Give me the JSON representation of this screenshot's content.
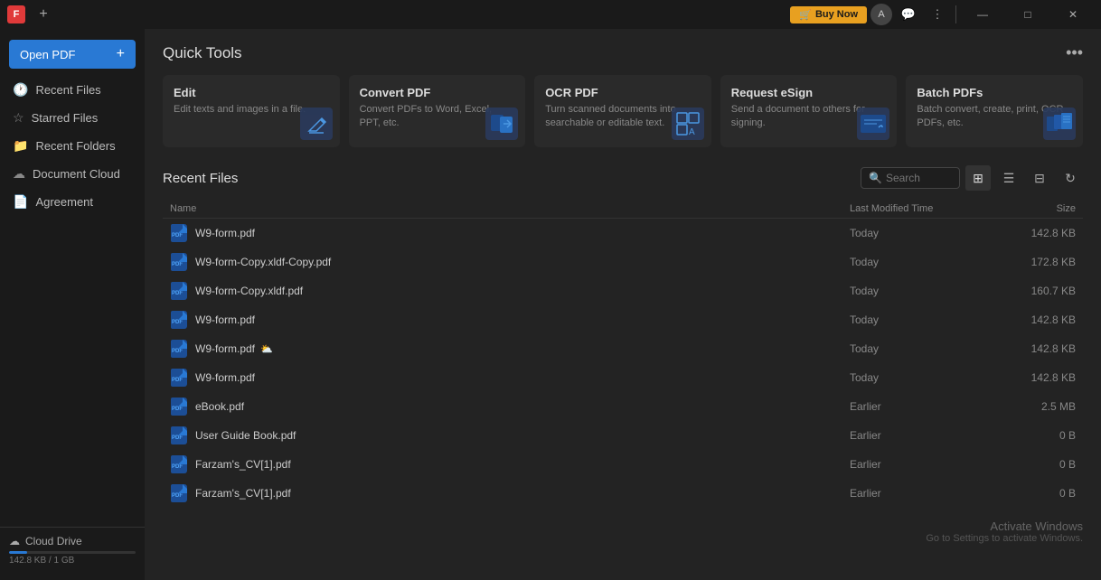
{
  "titlebar": {
    "app_logo": "F",
    "tab_plus": "+",
    "buy_now": "Buy Now",
    "avatar_initials": "A",
    "minimize": "—",
    "maximize": "□",
    "close": "✕"
  },
  "sidebar": {
    "open_pdf": "Open PDF",
    "add_icon": "+",
    "items": [
      {
        "id": "recent-files",
        "label": "Recent Files",
        "icon": "🕐"
      },
      {
        "id": "starred-files",
        "label": "Starred Files",
        "icon": "☆"
      },
      {
        "id": "recent-folders",
        "label": "Recent Folders",
        "icon": "📁"
      },
      {
        "id": "document-cloud",
        "label": "Document Cloud",
        "icon": "☁"
      },
      {
        "id": "agreement",
        "label": "Agreement",
        "icon": "📄"
      }
    ],
    "cloud_drive": "Cloud Drive",
    "storage_used": "142.8 KB / 1 GB"
  },
  "content": {
    "quick_tools_title": "Quick Tools",
    "more_icon": "•••",
    "tools": [
      {
        "id": "edit",
        "name": "Edit",
        "desc": "Edit texts and images in a file."
      },
      {
        "id": "convert-pdf",
        "name": "Convert PDF",
        "desc": "Convert PDFs to Word, Excel, PPT, etc."
      },
      {
        "id": "ocr-pdf",
        "name": "OCR PDF",
        "desc": "Turn scanned documents into searchable or editable text."
      },
      {
        "id": "request-esign",
        "name": "Request eSign",
        "desc": "Send a document to others for signing."
      },
      {
        "id": "batch-pdfs",
        "name": "Batch PDFs",
        "desc": "Batch convert, create, print, OCR PDFs, etc."
      }
    ],
    "recent_files_title": "Recent Files",
    "search_placeholder": "Search",
    "table_headers": {
      "name": "Name",
      "modified": "Last Modified Time",
      "size": "Size"
    },
    "files": [
      {
        "name": "W9-form.pdf",
        "modified": "Today",
        "size": "142.8 KB",
        "cloud": false
      },
      {
        "name": "W9-form-Copy.xldf-Copy.pdf",
        "modified": "Today",
        "size": "172.8 KB",
        "cloud": false
      },
      {
        "name": "W9-form-Copy.xldf.pdf",
        "modified": "Today",
        "size": "160.7 KB",
        "cloud": false
      },
      {
        "name": "W9-form.pdf",
        "modified": "Today",
        "size": "142.8 KB",
        "cloud": false
      },
      {
        "name": "W9-form.pdf",
        "modified": "Today",
        "size": "142.8 KB",
        "cloud": true
      },
      {
        "name": "W9-form.pdf",
        "modified": "Today",
        "size": "142.8 KB",
        "cloud": false
      },
      {
        "name": "eBook.pdf",
        "modified": "Earlier",
        "size": "2.5 MB",
        "cloud": false
      },
      {
        "name": "User Guide Book.pdf",
        "modified": "Earlier",
        "size": "0 B",
        "cloud": false
      },
      {
        "name": "Farzam's_CV[1].pdf",
        "modified": "Earlier",
        "size": "0 B",
        "cloud": false
      },
      {
        "name": "Farzam's_CV[1].pdf",
        "modified": "Earlier",
        "size": "0 B",
        "cloud": false
      }
    ]
  },
  "watermark": {
    "title": "Activate Windows",
    "sub": "Go to Settings to activate Windows."
  }
}
